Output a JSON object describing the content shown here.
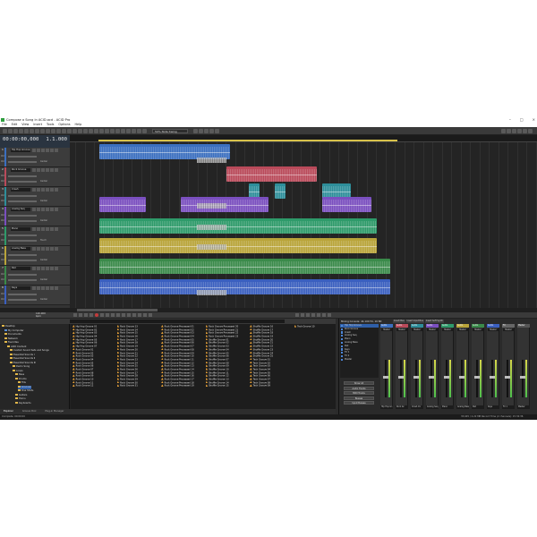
{
  "window": {
    "title": "Compose a Song in ACID.acd - ACID Pro"
  },
  "menu": [
    "File",
    "Edit",
    "View",
    "Insert",
    "Tools",
    "Options",
    "Help"
  ],
  "toolbar": {
    "swing_label": "50% Note Swing"
  },
  "timecode": {
    "time": "00:00:00,000",
    "beat": "1.1.000"
  },
  "tracks": [
    {
      "num": "1",
      "name": "Hip Hop Groove",
      "color": "#3b6fbf",
      "vol": "Vol",
      "pan": "Center"
    },
    {
      "num": "2",
      "name": "Rock Groove",
      "color": "#b94a5a",
      "vol": "Vol",
      "pan": "Center"
    },
    {
      "num": "3",
      "name": "Crash",
      "color": "#2e8e9a",
      "vol": "Vol",
      "pan": "Center"
    },
    {
      "num": "4",
      "name": "Analog Seq",
      "color": "#7a4fbf",
      "vol": "Vol",
      "pan": "Center"
    },
    {
      "num": "5",
      "name": "Piano",
      "color": "#2e9a6a",
      "vol": "Vol",
      "pan": "Touch"
    },
    {
      "num": "6",
      "name": "Analog Bass",
      "color": "#b9a43a",
      "vol": "Vol",
      "pan": "Center"
    },
    {
      "num": "7",
      "name": "Pad",
      "color": "#3a8a4a",
      "vol": "Vol",
      "pan": "Center"
    },
    {
      "num": "8",
      "name": "Keys",
      "color": "#3a5fbf",
      "vol": "Vol",
      "pan": "Center"
    }
  ],
  "transport": {
    "tempo": "120.000",
    "tempo_unit": "bpm"
  },
  "explorer": {
    "tree": [
      {
        "label": "Desktop",
        "depth": 0
      },
      {
        "label": "My Computer",
        "depth": 1
      },
      {
        "label": "Documents",
        "depth": 1
      },
      {
        "label": "Network",
        "depth": 1
      },
      {
        "label": "Favorites",
        "depth": 1
      },
      {
        "label": "ACID Content",
        "depth": 2
      },
      {
        "label": "Custom Sound Sets and Songs",
        "depth": 3
      },
      {
        "label": "Essential Sounds I",
        "depth": 3
      },
      {
        "label": "Essential Sounds II",
        "depth": 3
      },
      {
        "label": "Essential Sounds III",
        "depth": 3
      },
      {
        "label": "Demo Song",
        "depth": 4
      },
      {
        "label": "Loops",
        "depth": 4
      },
      {
        "label": "Bass",
        "depth": 5
      },
      {
        "label": "Drums",
        "depth": 5
      },
      {
        "label": "Fills",
        "depth": 6
      },
      {
        "label": "Grooves",
        "depth": 6
      },
      {
        "label": "One Shots",
        "depth": 6
      },
      {
        "label": "Guitars",
        "depth": 5
      },
      {
        "label": "Horns",
        "depth": 5
      },
      {
        "label": "Keyboards",
        "depth": 5
      }
    ],
    "selected_index": 15,
    "columns": [
      [
        "Hip Hop Groove 01",
        "Hip Hop Groove 02",
        "Hip Hop Groove 03",
        "Hip Hop Groove 04",
        "Hip Hop Groove 05",
        "Hip Hop Groove 06",
        "Hip Hop Groove 07",
        "Rock Groove 01",
        "Rock Groove 02",
        "Rock Groove 03",
        "Rock Groove 04",
        "Rock Groove 05",
        "Rock Groove 06",
        "Rock Groove 07",
        "Rock Groove 08",
        "Rock Groove 09",
        "Rock Groove 10",
        "Rock Groove 11",
        "Rock Groove 12"
      ],
      [
        "Rock Groove 13",
        "Rock Groove 14",
        "Rock Groove 15",
        "Rock Groove 16",
        "Rock Groove 17",
        "Rock Groove 18",
        "Rock Groove 19",
        "Rock Groove 20",
        "Rock Groove 21",
        "Rock Groove 22",
        "Rock Groove 23",
        "Rock Groove 24",
        "Rock Groove 25",
        "Rock Groove 26",
        "Rock Groove 27",
        "Rock Groove 28",
        "Rock Groove 29",
        "Rock Groove 30",
        "Rock Groove 31"
      ],
      [
        "Rock Groove Processed 01",
        "Rock Groove Processed 02",
        "Rock Groove Processed 03",
        "Rock Groove Processed 04",
        "Rock Groove Processed 05",
        "Rock Groove Processed 06",
        "Rock Groove Processed 07",
        "Rock Groove Processed 08",
        "Rock Groove Processed 09",
        "Rock Groove Processed 10",
        "Rock Groove Processed 11",
        "Rock Groove Processed 12",
        "Rock Groove Processed 13",
        "Rock Groove Processed 14",
        "Rock Groove Processed 15",
        "Rock Groove Processed 16",
        "Rock Groove Processed 17",
        "Rock Groove Processed 18",
        "Rock Groove Processed 19"
      ],
      [
        "Rock Groove Processed 20",
        "Rock Groove Processed 21",
        "Rock Groove Processed 22",
        "Rock Groove Processed 23",
        "Shuffle Groove 01",
        "Shuffle Groove 02",
        "Shuffle Groove 03",
        "Shuffle Groove 04",
        "Shuffle Groove 05",
        "Shuffle Groove 06",
        "Shuffle Groove 07",
        "Shuffle Groove 08",
        "Shuffle Groove 09",
        "Shuffle Groove 10",
        "Shuffle Groove 11",
        "Shuffle Groove 12",
        "Shuffle Groove 13",
        "Shuffle Groove 14",
        "Shuffle Groove 15"
      ],
      [
        "Shuffle Groove 16",
        "Shuffle Groove 17",
        "Shuffle Groove 18",
        "Shuffle Groove 19",
        "Shuffle Groove 20",
        "Shuffle Groove 21",
        "Shuffle Groove 22",
        "Shuffle Groove 23",
        "Shuffle Groove 24",
        "Shuffle Groove 25",
        "Tech Groove 01",
        "Tech Groove 02",
        "Tech Groove 03",
        "Tech Groove 04",
        "Tech Groove 05",
        "Tech Groove 06",
        "Tech Groove 07",
        "Tech Groove 08",
        "Tech Groove 09"
      ],
      [
        "Tech Groove 10"
      ]
    ],
    "tabs": [
      "Explorer",
      "Groove Pool",
      "Plug-in Manager"
    ]
  },
  "mixer": {
    "title": "Mixing Console: 44,100 Hz, 16 Bit",
    "tools": [
      "Insert Bus",
      "Insert Input Bus",
      "Insert Soft Synth"
    ],
    "list": [
      "Hip Hop Groove",
      "Rock Groove",
      "Crash",
      "Analog Seq",
      "Piano",
      "Analog Bass",
      "Pad",
      "Keys",
      "FX 1",
      "FX 2",
      "Master"
    ],
    "view_buttons": [
      "Show All",
      "Audio Tracks",
      "MIDI Tracks",
      "Busses",
      "Input Busses"
    ],
    "strips": [
      {
        "name": "Audio",
        "color": "#3b6fbf",
        "bus": "Master",
        "foot": "Hip Hop Gr."
      },
      {
        "name": "Audio",
        "color": "#b94a5a",
        "bus": "Master",
        "foot": "Rock Gr."
      },
      {
        "name": "Audio",
        "color": "#2e8e9a",
        "bus": "Master",
        "foot": "Crash 01"
      },
      {
        "name": "Audio",
        "color": "#7a4fbf",
        "bus": "Master",
        "foot": "Analog Seq"
      },
      {
        "name": "Audio",
        "color": "#2e9a6a",
        "bus": "Master",
        "foot": "Piano"
      },
      {
        "name": "Audio",
        "color": "#b9a43a",
        "bus": "Master",
        "foot": "Analog Bass"
      },
      {
        "name": "Audio",
        "color": "#3a8a4a",
        "bus": "Master",
        "foot": "Pad"
      },
      {
        "name": "Audio",
        "color": "#3a5fbf",
        "bus": "Master",
        "foot": "Keys"
      },
      {
        "name": "FX",
        "color": "#666666",
        "bus": "Master",
        "foot": "FX 1"
      },
      {
        "name": "Master",
        "color": "#555555",
        "bus": "",
        "foot": "Master"
      }
    ]
  },
  "status": {
    "left": "Complete: 00:00:00",
    "mid": "33,645 / 2,22 MB",
    "right": "Record Time (2 channels): 15:32:36"
  }
}
